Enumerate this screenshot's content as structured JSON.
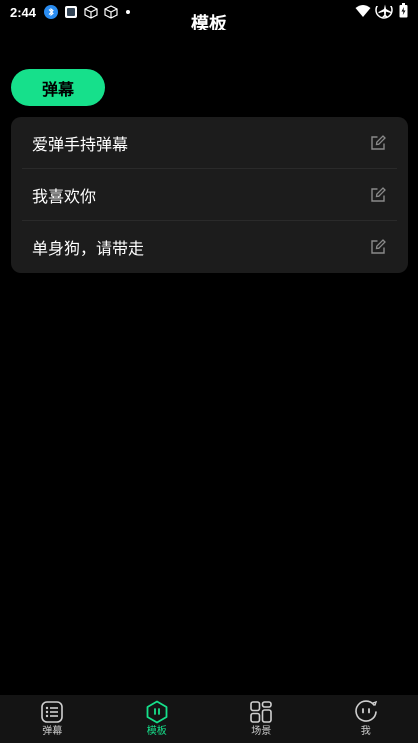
{
  "status_bar": {
    "time": "2:44"
  },
  "header": {
    "title": "模板"
  },
  "tabs": {
    "active_label": "弹幕"
  },
  "templates": [
    {
      "text": "爱弹手持弹幕"
    },
    {
      "text": "我喜欢你"
    },
    {
      "text": "单身狗，请带走"
    }
  ],
  "bottom_nav": {
    "items": [
      {
        "label": "弹幕",
        "icon": "list-icon"
      },
      {
        "label": "模板",
        "icon": "template-icon",
        "active": true
      },
      {
        "label": "场景",
        "icon": "grid-icon"
      },
      {
        "label": "我",
        "icon": "face-icon"
      }
    ]
  },
  "colors": {
    "accent": "#16e08b",
    "background": "#000000",
    "card": "#1c1c1c",
    "nav": "#141414"
  }
}
